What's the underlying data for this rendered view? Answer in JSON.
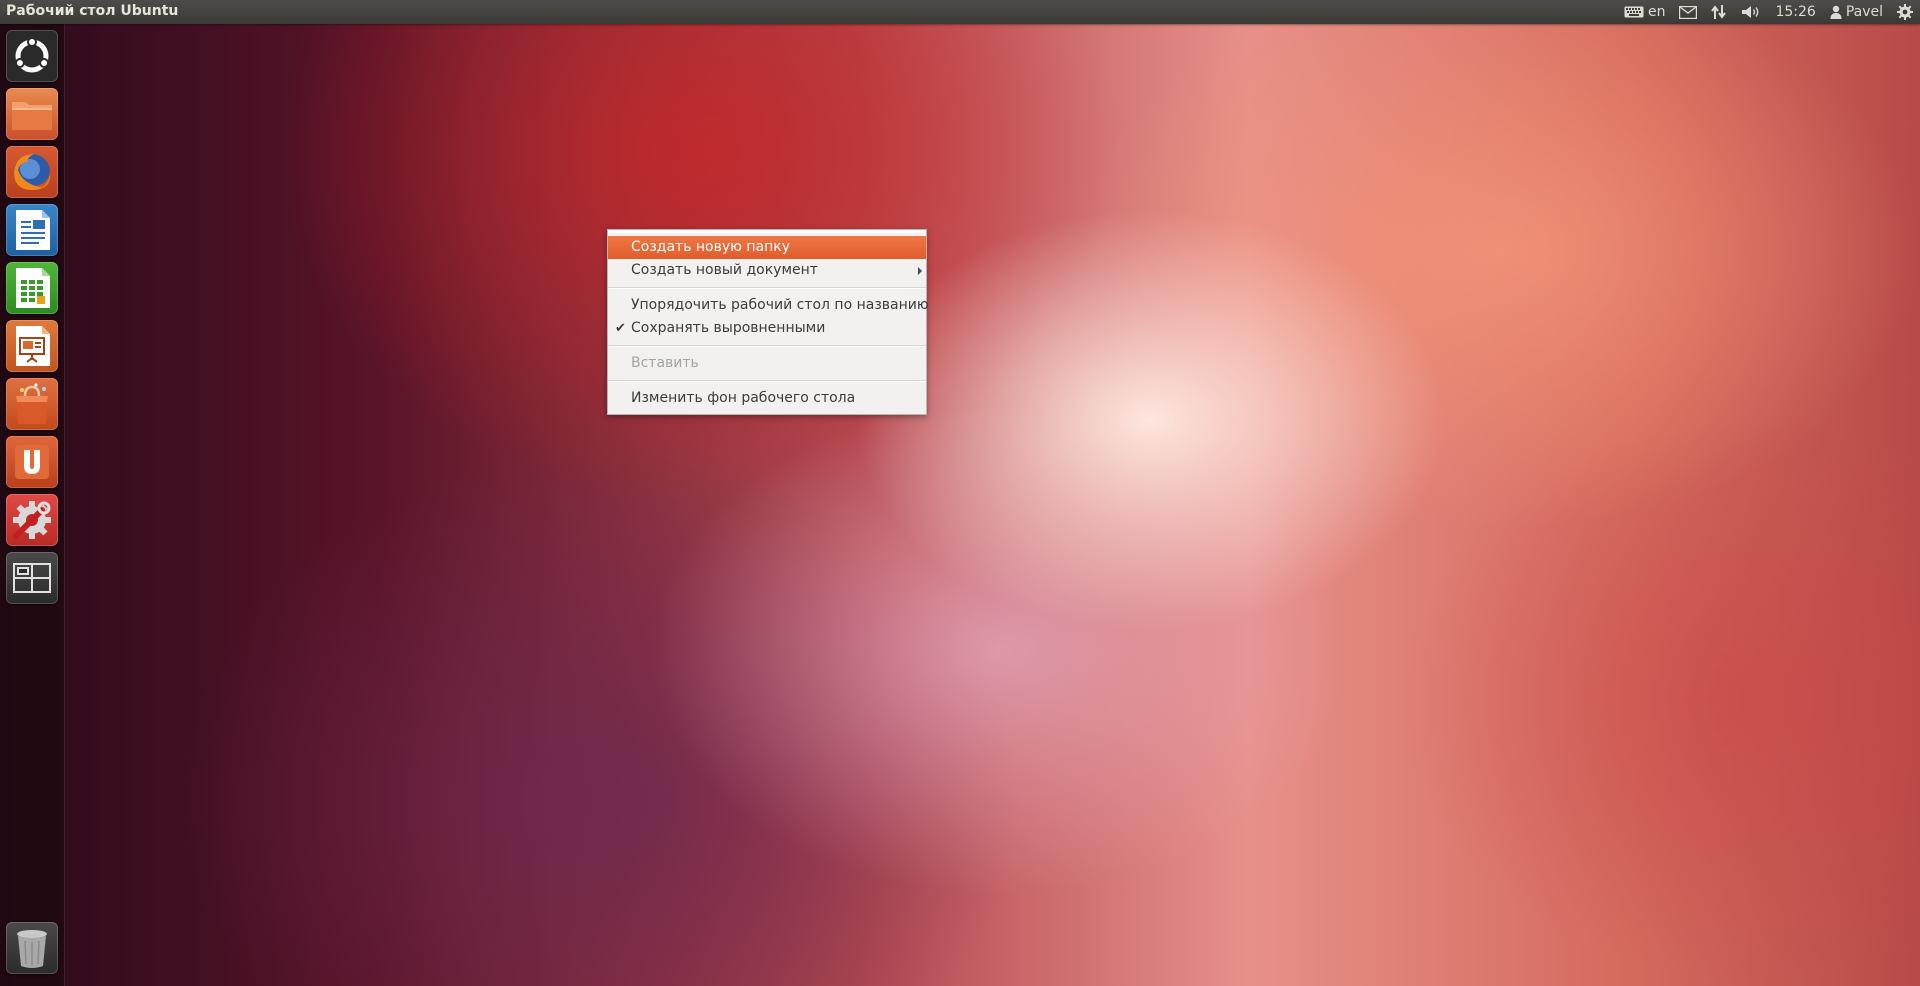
{
  "top_panel": {
    "title": "Рабочий стол Ubuntu",
    "keyboard_layout": "en",
    "clock": "15:26",
    "user": "Pavel"
  },
  "launcher": {
    "items": [
      {
        "id": "dash",
        "icon": "ubuntu-logo-icon"
      },
      {
        "id": "files",
        "icon": "folder-icon"
      },
      {
        "id": "firefox",
        "icon": "firefox-icon"
      },
      {
        "id": "writer",
        "icon": "libreoffice-writer-icon"
      },
      {
        "id": "calc",
        "icon": "libreoffice-calc-icon"
      },
      {
        "id": "impress",
        "icon": "libreoffice-impress-icon"
      },
      {
        "id": "software-center",
        "icon": "software-center-icon"
      },
      {
        "id": "ubuntu-one",
        "icon": "ubuntu-one-icon"
      },
      {
        "id": "system-settings",
        "icon": "system-settings-icon"
      },
      {
        "id": "workspace-switcher",
        "icon": "workspace-switcher-icon"
      },
      {
        "id": "trash",
        "icon": "trash-icon"
      }
    ]
  },
  "context_menu": {
    "items": {
      "create_folder": "Создать новую папку",
      "create_document": "Создать новый документ",
      "arrange_by_name": "Упорядочить рабочий стол по названию",
      "keep_aligned": "Сохранять выровненными",
      "paste": "Вставить",
      "change_background": "Изменить фон рабочего стола"
    },
    "keep_aligned_checked": true,
    "paste_enabled": false,
    "highlighted": "create_folder"
  },
  "colors": {
    "accent": "#e85e2d",
    "panel": "#3c3b37",
    "menu_bg": "#f2f1f0"
  }
}
